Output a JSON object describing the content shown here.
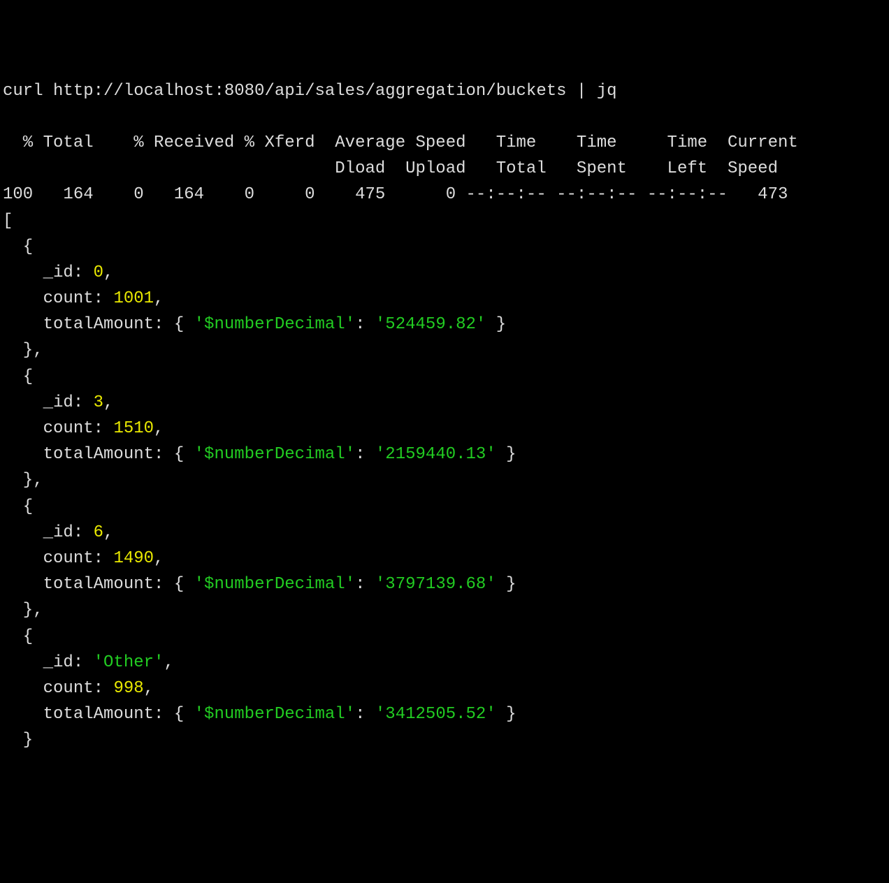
{
  "command": "curl http://localhost:8080/api/sales/aggregation/buckets | jq",
  "progress": {
    "header1": "  % Total    % Received % Xferd  Average Speed   Time    Time     Time  Current",
    "header2": "                                 Dload  Upload   Total   Spent    Left  Speed",
    "row": "100   164    0   164    0     0    475      0 --:--:-- --:--:-- --:--:--   473"
  },
  "json_open": "[",
  "results": [
    {
      "indent_open": "  {",
      "id_key": "    _id",
      "id_val": "0",
      "id_is_string": false,
      "count_key": "    count",
      "count_val": "1001",
      "amt_key": "    totalAmount",
      "nd_key": "'$numberDecimal'",
      "nd_val": "'524459.82'",
      "close": "  },"
    },
    {
      "indent_open": "  {",
      "id_key": "    _id",
      "id_val": "3",
      "id_is_string": false,
      "count_key": "    count",
      "count_val": "1510",
      "amt_key": "    totalAmount",
      "nd_key": "'$numberDecimal'",
      "nd_val": "'2159440.13'",
      "close": "  },"
    },
    {
      "indent_open": "  {",
      "id_key": "    _id",
      "id_val": "6",
      "id_is_string": false,
      "count_key": "    count",
      "count_val": "1490",
      "amt_key": "    totalAmount",
      "nd_key": "'$numberDecimal'",
      "nd_val": "'3797139.68'",
      "close": "  },"
    },
    {
      "indent_open": "  {",
      "id_key": "    _id",
      "id_val": "'Other'",
      "id_is_string": true,
      "count_key": "    count",
      "count_val": "998",
      "amt_key": "    totalAmount",
      "nd_key": "'$numberDecimal'",
      "nd_val": "'3412505.52'",
      "close": "  }"
    }
  ]
}
